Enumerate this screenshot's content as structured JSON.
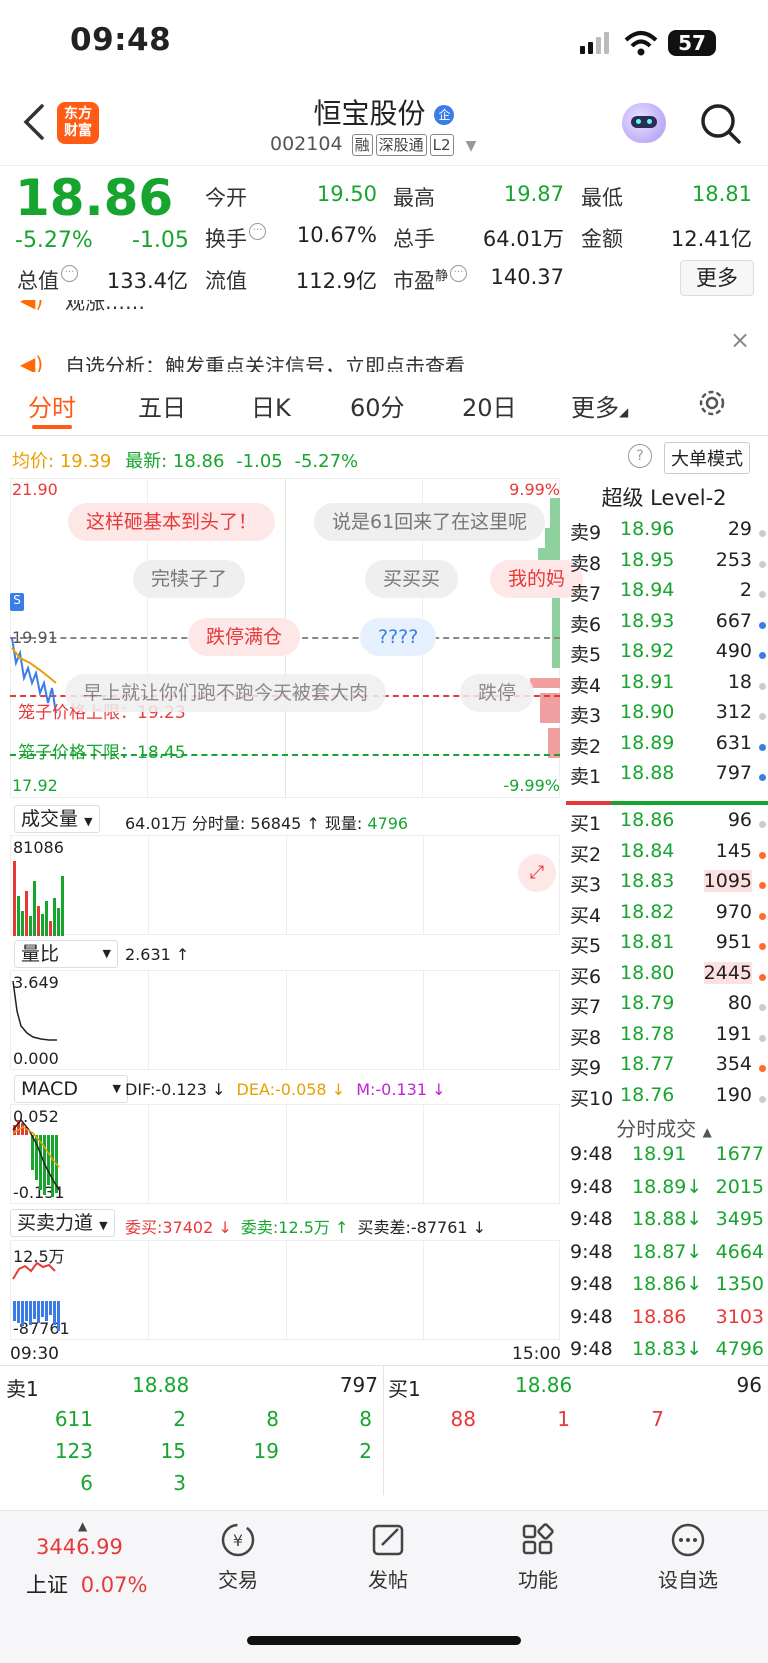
{
  "status_bar": {
    "time": "09:48",
    "battery": "57"
  },
  "header": {
    "logo_text_1": "东方",
    "logo_text_2": "财富",
    "title": "恒宝股份",
    "title_badge": "企",
    "code": "002104",
    "tags": [
      "融",
      "深股通",
      "L2"
    ]
  },
  "quote": {
    "price": "18.86",
    "change_pct": "-5.27%",
    "change": "-1.05",
    "fields": [
      {
        "label": "今开",
        "value": "19.50",
        "color": "green"
      },
      {
        "label": "最高",
        "value": "19.87",
        "color": "green"
      },
      {
        "label": "最低",
        "value": "18.81",
        "color": "green"
      },
      {
        "label": "换手",
        "value": "10.67%",
        "color": "dark"
      },
      {
        "label": "总手",
        "value": "64.01万",
        "color": "dark"
      },
      {
        "label": "金额",
        "value": "12.41亿",
        "color": "dark"
      },
      {
        "label": "总值",
        "value": "133.4亿",
        "color": "dark"
      },
      {
        "label": "流值",
        "value": "112.9亿",
        "color": "dark"
      },
      {
        "label": "市盈",
        "value": "140.37",
        "color": "dark"
      }
    ],
    "pe_superscript": "静",
    "more_button": "更多"
  },
  "notices": {
    "line1": "观涨……",
    "line2": "自选分析：触发重点关注信号，立即点击查看"
  },
  "tabs": [
    "分时",
    "五日",
    "日K",
    "60分",
    "20日",
    "更多"
  ],
  "info_row": {
    "avg_label": "均价:",
    "avg_value": "19.39",
    "latest_label": "最新:",
    "latest_value": "18.86",
    "latest_change": "-1.05",
    "latest_pct": "-5.27%",
    "big_order_mode": "大单模式"
  },
  "chart_axes": {
    "top_left": "21.90",
    "top_right": "9.99%",
    "mid_left": "19.91",
    "bottom_left": "17.92",
    "bottom_right": "-9.99%",
    "cage_upper": "笼子价格上限：19.23",
    "cage_lower": "笼子价格下限：18.45"
  },
  "bubbles": [
    {
      "text": "这样砸基本到头了！",
      "style": "red"
    },
    {
      "text": "说是61回来了在这里呢",
      "style": "gray"
    },
    {
      "text": "完犊子了",
      "style": "gray"
    },
    {
      "text": "买买买",
      "style": "gray"
    },
    {
      "text": "我的妈",
      "style": "red"
    },
    {
      "text": "跌停满仓",
      "style": "red"
    },
    {
      "text": "????",
      "style": "blue"
    },
    {
      "text": "早上就让你们跑不跑今天被套大肉",
      "style": "gray"
    },
    {
      "text": "跌停",
      "style": "gray"
    }
  ],
  "volume_panel": {
    "selector": "成交量",
    "total": "64.01万",
    "minute_label": "分时量:",
    "minute_value": "56845",
    "now_label": "现量:",
    "now_value": "4796",
    "max_label": "81086"
  },
  "ratio_panel": {
    "selector": "量比",
    "value": "2.631",
    "max_label": "3.649",
    "min_label": "0.000"
  },
  "macd_panel": {
    "selector": "MACD",
    "dif": "DIF:-0.123",
    "dea": "DEA:-0.058",
    "m": "M:-0.131",
    "max_label": "0.052",
    "min_label": "-0.131"
  },
  "force_panel": {
    "selector": "买卖力道",
    "buy": "委买:37402",
    "sell": "委卖:12.5万",
    "diff": "买卖差:-87761",
    "max_label": "12.5万",
    "min_label": "-87761"
  },
  "time_axis": {
    "start": "09:30",
    "end": "15:00"
  },
  "level2": {
    "title": "超级 Level-2",
    "asks": [
      {
        "label": "卖9",
        "price": "18.96",
        "vol": "29",
        "dot": "gray"
      },
      {
        "label": "卖8",
        "price": "18.95",
        "vol": "253",
        "dot": "gray"
      },
      {
        "label": "卖7",
        "price": "18.94",
        "vol": "2",
        "dot": "gray"
      },
      {
        "label": "卖6",
        "price": "18.93",
        "vol": "667",
        "dot": "blue"
      },
      {
        "label": "卖5",
        "price": "18.92",
        "vol": "490",
        "dot": "blue"
      },
      {
        "label": "卖4",
        "price": "18.91",
        "vol": "18",
        "dot": "gray"
      },
      {
        "label": "卖3",
        "price": "18.90",
        "vol": "312",
        "dot": "gray"
      },
      {
        "label": "卖2",
        "price": "18.89",
        "vol": "631",
        "dot": "blue"
      },
      {
        "label": "卖1",
        "price": "18.88",
        "vol": "797",
        "dot": "blue"
      }
    ],
    "bids": [
      {
        "label": "买1",
        "price": "18.86",
        "vol": "96",
        "dot": "gray"
      },
      {
        "label": "买2",
        "price": "18.84",
        "vol": "145",
        "dot": "orange"
      },
      {
        "label": "买3",
        "price": "18.83",
        "vol": "1095",
        "dot": "orange"
      },
      {
        "label": "买4",
        "price": "18.82",
        "vol": "970",
        "dot": "orange"
      },
      {
        "label": "买5",
        "price": "18.81",
        "vol": "951",
        "dot": "orange"
      },
      {
        "label": "买6",
        "price": "18.80",
        "vol": "2445",
        "dot": "orange"
      },
      {
        "label": "买7",
        "price": "18.79",
        "vol": "80",
        "dot": "gray"
      },
      {
        "label": "买8",
        "price": "18.78",
        "vol": "191",
        "dot": "gray"
      },
      {
        "label": "买9",
        "price": "18.77",
        "vol": "354",
        "dot": "orange"
      },
      {
        "label": "买10",
        "price": "18.76",
        "vol": "190",
        "dot": "gray"
      }
    ],
    "ticks_title": "分时成交",
    "ticks": [
      {
        "time": "9:48",
        "price": "18.91",
        "vol": "1677",
        "color": "green"
      },
      {
        "time": "9:48",
        "price": "18.89↓",
        "vol": "2015",
        "color": "green"
      },
      {
        "time": "9:48",
        "price": "18.88↓",
        "vol": "3495",
        "color": "green"
      },
      {
        "time": "9:48",
        "price": "18.87↓",
        "vol": "4664",
        "color": "green"
      },
      {
        "time": "9:48",
        "price": "18.86↓",
        "vol": "1350",
        "color": "green"
      },
      {
        "time": "9:48",
        "price": "18.86",
        "vol": "3103",
        "color": "red"
      },
      {
        "time": "9:48",
        "price": "18.83↓",
        "vol": "4796",
        "color": "green"
      }
    ]
  },
  "queue": {
    "sell_label": "卖1",
    "sell_price": "18.88",
    "sell_vol": "797",
    "buy_label": "买1",
    "buy_price": "18.86",
    "buy_vol": "96",
    "sell_rows": [
      [
        "611",
        "2",
        "8",
        "8"
      ],
      [
        "123",
        "15",
        "19",
        "2"
      ],
      [
        "6",
        "3",
        "",
        ""
      ]
    ],
    "buy_rows": [
      [
        "88",
        "1",
        "7"
      ]
    ]
  },
  "nav": {
    "index_value": "3446.99",
    "index_name": "上证",
    "index_pct": "0.07%",
    "items": [
      "交易",
      "发帖",
      "功能",
      "设自选"
    ]
  }
}
